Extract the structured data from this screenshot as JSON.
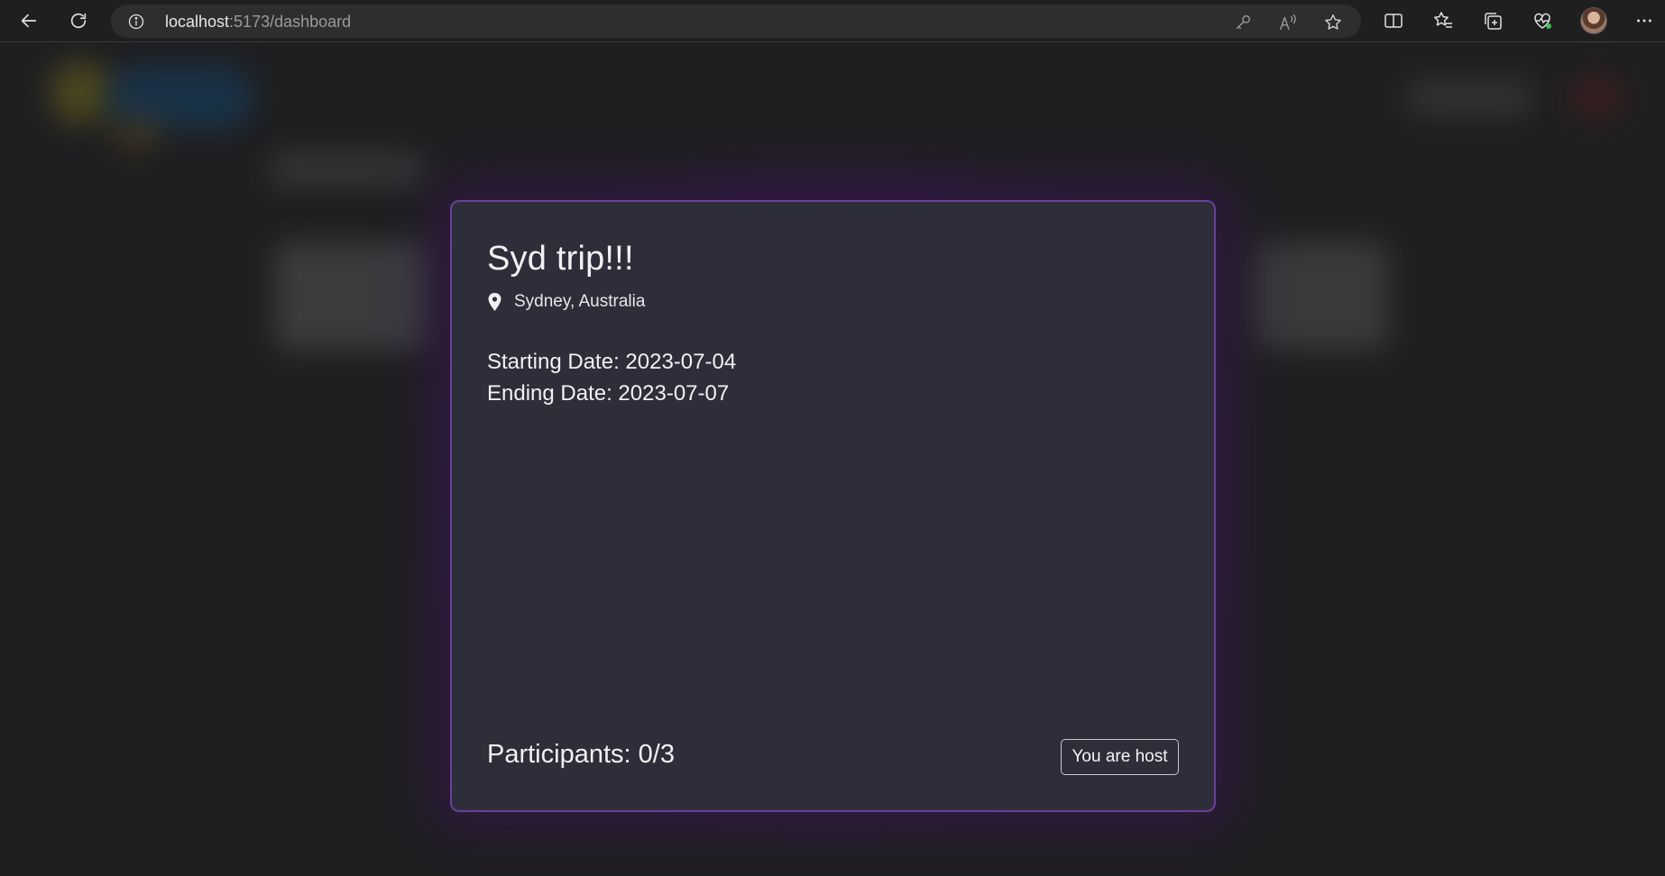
{
  "browser": {
    "url_host": "localhost",
    "url_path": ":5173/dashboard",
    "icons": [
      "back-icon",
      "refresh-icon",
      "info-icon",
      "key-icon",
      "read-aloud-icon",
      "favorite-star-icon",
      "split-screen-icon",
      "favorites-icon",
      "collections-icon",
      "browser-essentials-icon",
      "profile-avatar",
      "more-menu-icon"
    ]
  },
  "trip": {
    "title": "Syd trip!!!",
    "location": "Sydney, Australia",
    "starting_date": "Starting Date: 2023-07-04",
    "ending_date": "Ending Date: 2023-07-07",
    "participants": "Participants: 0/3",
    "host_label": "You are host"
  },
  "colors": {
    "card_background": "#2e2e3a",
    "card_border": "#6b3f9a",
    "page_background": "#1f1f21"
  }
}
